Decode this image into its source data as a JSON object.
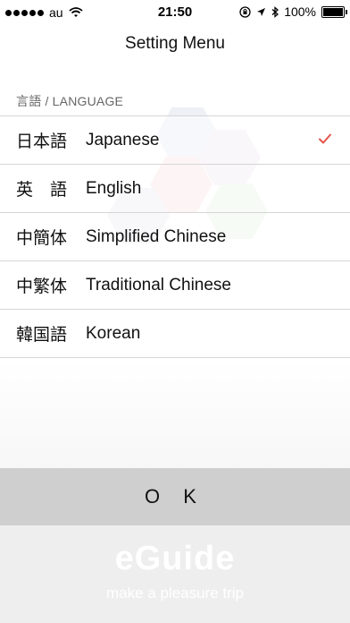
{
  "status_bar": {
    "carrier": "au",
    "time": "21:50",
    "battery": "100%"
  },
  "nav": {
    "title": "Setting Menu"
  },
  "language_section": {
    "header": "言語 / LANGUAGE",
    "items": [
      {
        "native": "日本語",
        "english": "Japanese",
        "selected": true
      },
      {
        "native": "英　語",
        "english": "English",
        "selected": false
      },
      {
        "native": "中簡体",
        "english": "Simplified Chinese",
        "selected": false
      },
      {
        "native": "中繁体",
        "english": "Traditional Chinese",
        "selected": false
      },
      {
        "native": "韓国語",
        "english": "Korean",
        "selected": false
      }
    ]
  },
  "ok_button": {
    "label": "O K"
  },
  "branding": {
    "logo": "eGuide",
    "tagline": "make a pleasure trip"
  },
  "colors": {
    "check": "#e5534b",
    "ok_bar": "#cfcfcf",
    "divider": "#d6d6d6"
  }
}
